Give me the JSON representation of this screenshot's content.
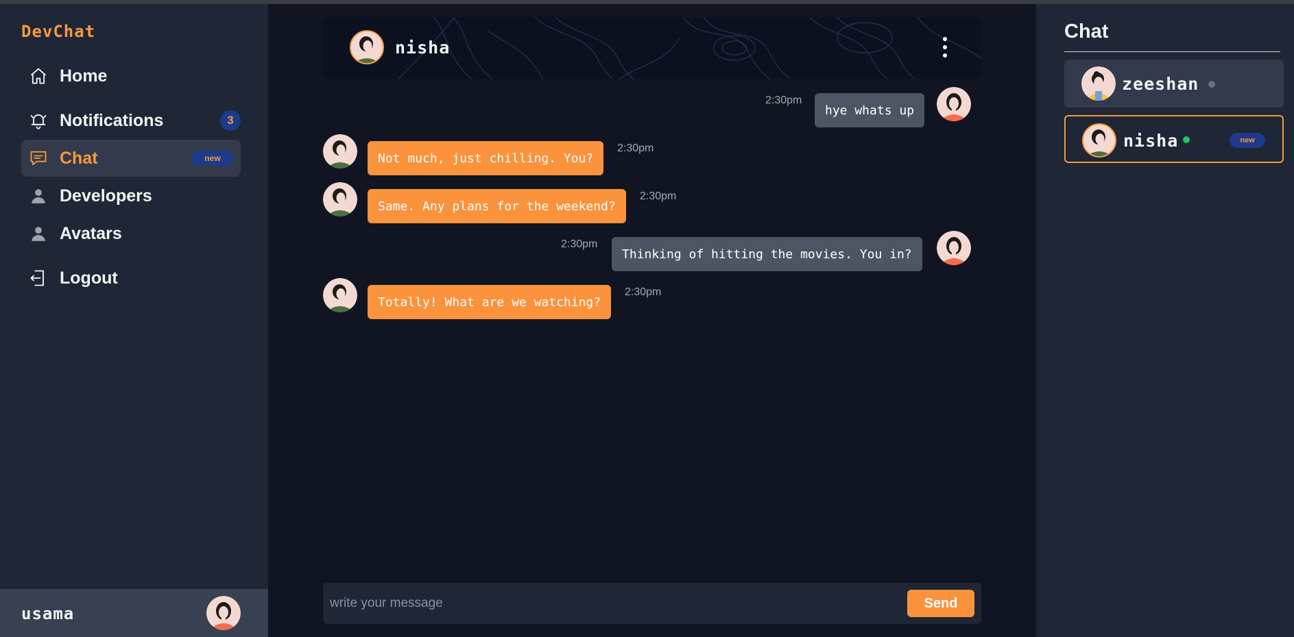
{
  "app": {
    "brand": "DevChat"
  },
  "sidebar": {
    "items": [
      {
        "label": "Home",
        "icon": "home-icon"
      },
      {
        "label": "Notifications",
        "icon": "bell-icon",
        "count": "3"
      },
      {
        "label": "Chat",
        "icon": "chat-bubble-icon",
        "badge": "new",
        "active": true
      },
      {
        "label": "Developers",
        "icon": "user-icon"
      },
      {
        "label": "Avatars",
        "icon": "user-icon"
      },
      {
        "label": "Logout",
        "icon": "logout-icon"
      }
    ],
    "current_user": "usama"
  },
  "chat": {
    "header_name": "nisha",
    "messages": [
      {
        "direction": "out",
        "text": "hye whats up",
        "time": "2:30pm"
      },
      {
        "direction": "in",
        "text": "Not much, just chilling. You?",
        "time": "2:30pm"
      },
      {
        "direction": "in",
        "text": "Same. Any plans for the weekend?",
        "time": "2:30pm"
      },
      {
        "direction": "out",
        "text": "Thinking of hitting the movies. You in?",
        "time": "2:30pm"
      },
      {
        "direction": "in",
        "text": "Totally! What are we watching?",
        "time": "2:30pm"
      }
    ],
    "composer": {
      "placeholder": "write your message",
      "value": "",
      "send_label": "Send"
    }
  },
  "right_panel": {
    "title": "Chat",
    "contacts": [
      {
        "name": "zeeshan",
        "status": "offline"
      },
      {
        "name": "nisha",
        "status": "online",
        "badge": "new",
        "selected": true
      }
    ]
  },
  "colors": {
    "accent": "#f59a3e",
    "incoming_bubble": "#fb923c",
    "outgoing_bubble": "#4b5563",
    "badge_bg": "#1e3a8a",
    "online": "#22c55e",
    "offline": "#6b7280"
  }
}
